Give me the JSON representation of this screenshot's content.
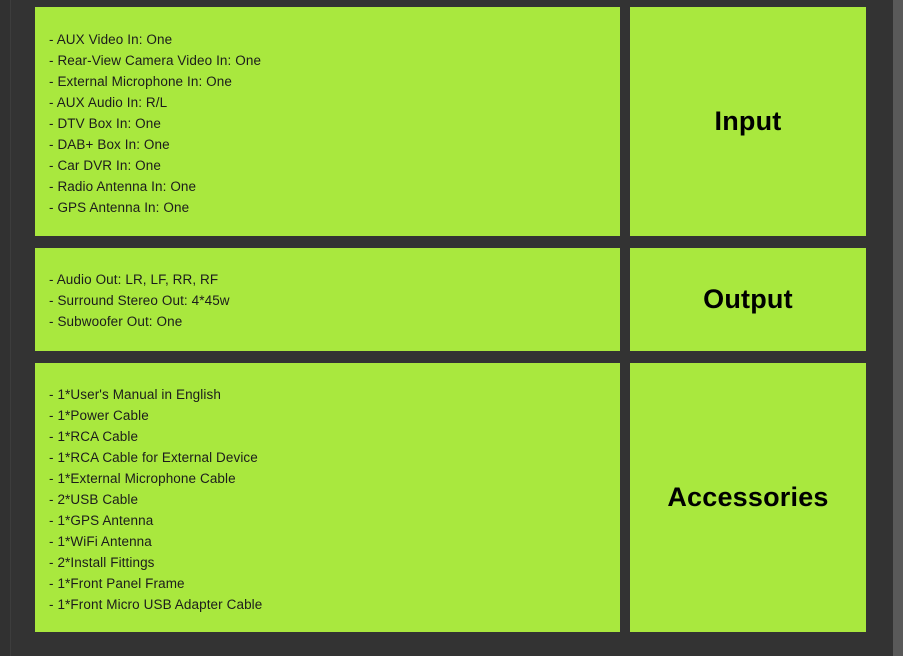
{
  "theme": {
    "panel_color": "#A9E83E",
    "background_color": "#333333",
    "text_color": "#1c1c1c",
    "heading_color": "#000000",
    "gutter_color": "#313131",
    "right_strip_color": "#595959"
  },
  "sections": [
    {
      "label": "Input",
      "items": [
        "- AUX Video In: One",
        "- Rear-View Camera Video In: One",
        "- External Microphone In: One",
        "- AUX Audio In: R/L",
        "- DTV Box In: One",
        "- DAB+ Box In: One",
        "- Car DVR In: One",
        "- Radio Antenna In: One",
        "- GPS Antenna In: One"
      ]
    },
    {
      "label": "Output",
      "items": [
        "- Audio Out: LR, LF, RR, RF",
        "- Surround Stereo Out: 4*45w",
        "- Subwoofer Out: One"
      ]
    },
    {
      "label": "Accessories",
      "items": [
        "- 1*User's Manual in English",
        "- 1*Power Cable",
        "- 1*RCA Cable",
        "- 1*RCA Cable for External Device",
        "- 1*External Microphone Cable",
        "- 2*USB Cable",
        "- 1*GPS Antenna",
        "- 1*WiFi Antenna",
        "- 2*Install Fittings",
        "- 1*Front Panel Frame",
        "- 1*Front Micro USB Adapter Cable"
      ]
    }
  ]
}
